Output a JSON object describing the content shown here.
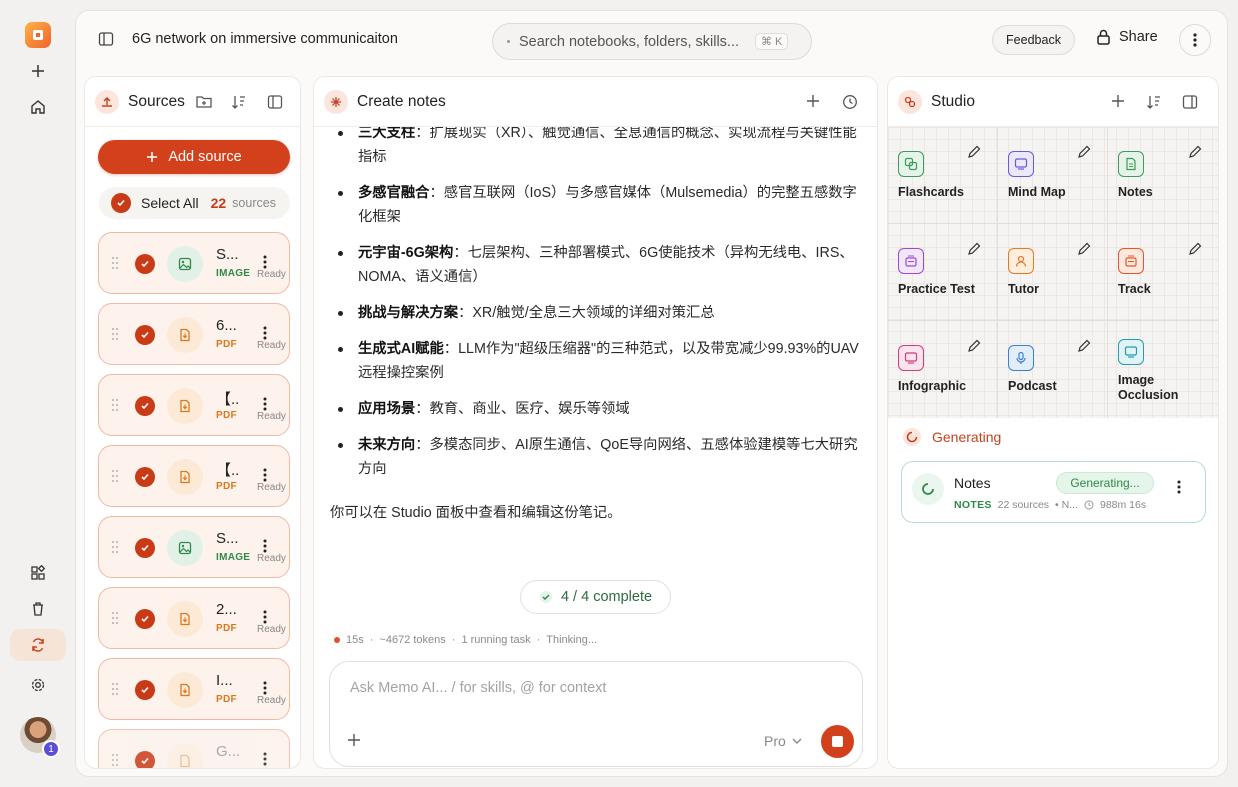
{
  "app": {
    "notebook_title": "6G network on immersive communicaiton",
    "search_placeholder": "Search notebooks, folders, skills...",
    "search_shortcut": "⌘ K",
    "feedback_label": "Feedback",
    "share_label": "Share",
    "accent_color": "#d3401c"
  },
  "rail": {
    "icons": [
      "app-logo",
      "plus-icon",
      "home-icon",
      "apps-icon",
      "trash-icon",
      "sync-icon",
      "settings-icon"
    ],
    "active": "sync-icon",
    "avatar_badge": "1"
  },
  "sources": {
    "title": "Sources",
    "add_label": "Add source",
    "select_all_label": "Select All",
    "count": "22",
    "count_unit": "sources",
    "items": [
      {
        "name": "S...",
        "type": "IMAGE",
        "status": "Ready",
        "icon": "image-icon"
      },
      {
        "name": "6...",
        "type": "PDF",
        "status": "Ready",
        "icon": "pdf-icon"
      },
      {
        "name": "【..",
        "type": "PDF",
        "status": "Ready",
        "icon": "pdf-icon"
      },
      {
        "name": "【..",
        "type": "PDF",
        "status": "Ready",
        "icon": "pdf-icon"
      },
      {
        "name": "S...",
        "type": "IMAGE",
        "status": "Ready",
        "icon": "image-icon"
      },
      {
        "name": "2...",
        "type": "PDF",
        "status": "Ready",
        "icon": "pdf-icon"
      },
      {
        "name": "I...",
        "type": "PDF",
        "status": "Ready",
        "icon": "pdf-icon"
      },
      {
        "name": "G...",
        "type": "",
        "status": "",
        "icon": "pdf-icon"
      }
    ]
  },
  "notes": {
    "title": "Create notes",
    "bullets": [
      {
        "bold": "三大支柱",
        "text": "：扩展现实（XR）、触觉通信、全息通信的概念、实现流程与关键性能指标"
      },
      {
        "bold": "多感官融合",
        "text": "：感官互联网（IoS）与多感官媒体（Mulsemedia）的完整五感数字化框架"
      },
      {
        "bold": "元宇宙-6G架构",
        "text": "：七层架构、三种部署模式、6G使能技术（异构无线电、IRS、NOMA、语义通信）"
      },
      {
        "bold": "挑战与解决方案",
        "text": "：XR/触觉/全息三大领域的详细对策汇总"
      },
      {
        "bold": "生成式AI赋能",
        "text": "：LLM作为\"超级压缩器\"的三种范式，以及带宽减少99.93%的UAV远程操控案例"
      },
      {
        "bold": "应用场景",
        "text": "：教育、商业、医疗、娱乐等领域"
      },
      {
        "bold": "未来方向",
        "text": "：多模态同步、AI原生通信、QoE导向网络、五感体验建模等七大研究方向"
      }
    ],
    "footer_text": "你可以在 Studio 面板中查看和编辑这份笔记。",
    "complete_label": "4 / 4 complete",
    "status": {
      "time": "15s",
      "tokens": "~4672 tokens",
      "tasks": "1 running task",
      "state": "Thinking..."
    },
    "composer_placeholder": "Ask Memo AI... / for skills, @ for context",
    "model_label": "Pro"
  },
  "studio": {
    "title": "Studio",
    "tools": [
      {
        "label": "Flashcards",
        "icon": "flashcards-icon",
        "color": "#3f9a5b",
        "bg": "#e4f4e8"
      },
      {
        "label": "Mind Map",
        "icon": "mindmap-icon",
        "color": "#6a5bd6",
        "bg": "#ebe8fa"
      },
      {
        "label": "Notes",
        "icon": "notes-icon",
        "color": "#3f9a5b",
        "bg": "#e4f4e8"
      },
      {
        "label": "Practice Test",
        "icon": "practice-test-icon",
        "color": "#9a4bd1",
        "bg": "#f1e6fa"
      },
      {
        "label": "Tutor",
        "icon": "tutor-icon",
        "color": "#e07a2a",
        "bg": "#fdeede"
      },
      {
        "label": "Track",
        "icon": "track-icon",
        "color": "#e0582a",
        "bg": "#fde8de"
      },
      {
        "label": "Infographic",
        "icon": "infographic-icon",
        "color": "#d43c78",
        "bg": "#fbe4ee"
      },
      {
        "label": "Podcast",
        "icon": "podcast-icon",
        "color": "#3a7fd6",
        "bg": "#e3eefb"
      },
      {
        "label": "Image Occlusion",
        "icon": "image-occlusion-icon",
        "color": "#2a9ab0",
        "bg": "#e0f3f6"
      }
    ],
    "generating_label": "Generating",
    "job": {
      "title": "Notes",
      "pill": "Generating...",
      "type": "NOTES",
      "sources": "22 sources",
      "extra": "• N...",
      "eta": "988m 16s"
    }
  }
}
